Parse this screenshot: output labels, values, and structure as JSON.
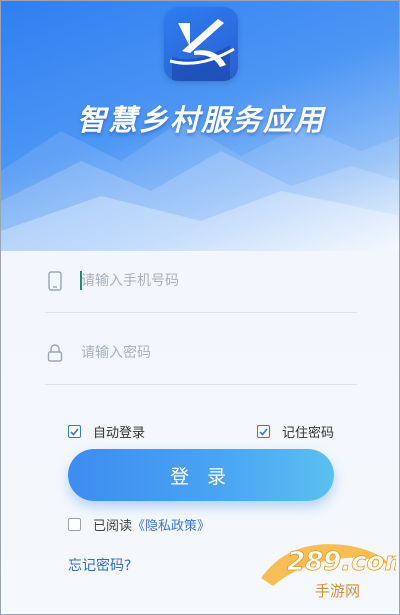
{
  "app": {
    "title": "智慧乡村服务应用"
  },
  "form": {
    "phone_placeholder": "请输入手机号码",
    "password_placeholder": "请输入密码",
    "auto_login_label": "自动登录",
    "auto_login_checked": true,
    "remember_password_label": "记住密码",
    "remember_password_checked": true,
    "login_label": "登 录",
    "agree_prefix": "已阅读",
    "privacy_link": "《隐私政策》",
    "agree_checked": false,
    "forgot_label": "忘记密码?"
  },
  "watermark": {
    "brand": "289.com",
    "tagline": "手游网"
  },
  "colors": {
    "primary": "#3d8cf0",
    "link": "#2d6fcd",
    "hero_top": "#2f7ff0"
  },
  "icons": {
    "phone": "phone-icon",
    "lock": "lock-icon",
    "check": "check-icon"
  }
}
